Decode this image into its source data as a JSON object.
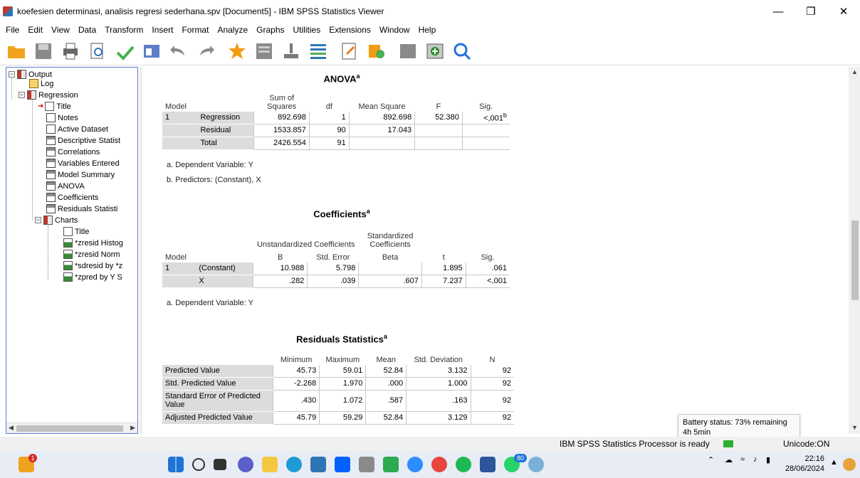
{
  "window": {
    "title": "koefesien determinasi, analisis regresi sederhana.spv [Document5] - IBM SPSS Statistics Viewer"
  },
  "menus": [
    {
      "label": "File"
    },
    {
      "label": "Edit"
    },
    {
      "label": "View"
    },
    {
      "label": "Data"
    },
    {
      "label": "Transform"
    },
    {
      "label": "Insert"
    },
    {
      "label": "Format"
    },
    {
      "label": "Analyze"
    },
    {
      "label": "Graphs"
    },
    {
      "label": "Utilities"
    },
    {
      "label": "Extensions"
    },
    {
      "label": "Window"
    },
    {
      "label": "Help"
    }
  ],
  "toolbar_icons": [
    "open-folder-icon",
    "save-icon",
    "print-icon",
    "print-preview-icon",
    "export-icon",
    "recall-dialog-icon",
    "undo-icon",
    "redo-icon",
    "goto-data-icon",
    "goto-case-icon",
    "goto-variable-icon",
    "variables-icon",
    "designate-window-icon",
    "show-all-icon",
    "select-last-output-icon",
    "hide-icon",
    "insert-output-icon",
    "search-icon"
  ],
  "tree": [
    {
      "label": "Output",
      "level": 0,
      "icon": "book",
      "toggle": "−"
    },
    {
      "label": "Log",
      "level": 1,
      "icon": "log"
    },
    {
      "label": "Regression",
      "level": 1,
      "icon": "book",
      "toggle": "−"
    },
    {
      "label": "Title",
      "level": 2,
      "icon": "title",
      "current": true
    },
    {
      "label": "Notes",
      "level": 2,
      "icon": "note"
    },
    {
      "label": "Active Dataset",
      "level": 2,
      "icon": "note"
    },
    {
      "label": "Descriptive Statist",
      "level": 2,
      "icon": "table"
    },
    {
      "label": "Correlations",
      "level": 2,
      "icon": "table"
    },
    {
      "label": "Variables Entered",
      "level": 2,
      "icon": "table"
    },
    {
      "label": "Model Summary",
      "level": 2,
      "icon": "table"
    },
    {
      "label": "ANOVA",
      "level": 2,
      "icon": "table"
    },
    {
      "label": "Coefficients",
      "level": 2,
      "icon": "table"
    },
    {
      "label": "Residuals Statisti",
      "level": 2,
      "icon": "table"
    },
    {
      "label": "Charts",
      "level": 2,
      "icon": "book",
      "toggle": "−"
    },
    {
      "label": "Title",
      "level": 3,
      "icon": "title"
    },
    {
      "label": "*zresid Histog",
      "level": 3,
      "icon": "chart"
    },
    {
      "label": "*zresid Norm",
      "level": 3,
      "icon": "chart"
    },
    {
      "label": "*sdresid by *z",
      "level": 3,
      "icon": "chart"
    },
    {
      "label": "*zpred by Y S",
      "level": 3,
      "icon": "chart"
    }
  ],
  "anova": {
    "title": "ANOVA",
    "title_sup": "a",
    "headers": {
      "model": "Model",
      "ss": "Sum of Squares",
      "df": "df",
      "ms": "Mean Square",
      "f": "F",
      "sig": "Sig."
    },
    "model_num": "1",
    "rows": [
      {
        "label": "Regression",
        "ss": "892.698",
        "df": "1",
        "ms": "892.698",
        "f": "52.380",
        "sig": "<,001",
        "sig_sup": "b"
      },
      {
        "label": "Residual",
        "ss": "1533.857",
        "df": "90",
        "ms": "17.043",
        "f": "",
        "sig": ""
      },
      {
        "label": "Total",
        "ss": "2426.554",
        "df": "91",
        "ms": "",
        "f": "",
        "sig": ""
      }
    ],
    "footnotes": [
      "a. Dependent Variable: Y",
      "b. Predictors: (Constant), X"
    ]
  },
  "coefficients": {
    "title": "Coefficients",
    "title_sup": "a",
    "headers": {
      "model": "Model",
      "unstd": "Unstandardized Coefficients",
      "std": "Standardized Coefficients",
      "b": "B",
      "se": "Std. Error",
      "beta": "Beta",
      "t": "t",
      "sig": "Sig."
    },
    "model_num": "1",
    "rows": [
      {
        "label": "(Constant)",
        "b": "10.988",
        "se": "5.798",
        "beta": "",
        "t": "1.895",
        "sig": ".061"
      },
      {
        "label": "X",
        "b": ".282",
        "se": ".039",
        "beta": ".607",
        "t": "7.237",
        "sig": "<,001"
      }
    ],
    "footnotes": [
      "a. Dependent Variable: Y"
    ]
  },
  "residuals": {
    "title": "Residuals Statistics",
    "title_sup": "a",
    "headers": {
      "min": "Minimum",
      "max": "Maximum",
      "mean": "Mean",
      "sd": "Std. Deviation",
      "n": "N"
    },
    "rows": [
      {
        "label": "Predicted Value",
        "min": "45.73",
        "max": "59.01",
        "mean": "52.84",
        "sd": "3.132",
        "n": "92"
      },
      {
        "label": "Std. Predicted Value",
        "min": "-2.268",
        "max": "1.970",
        "mean": ".000",
        "sd": "1.000",
        "n": "92"
      },
      {
        "label": "Standard Error of Predicted Value",
        "min": ".430",
        "max": "1.072",
        "mean": ".587",
        "sd": ".163",
        "n": "92"
      },
      {
        "label": "Adjusted Predicted Value",
        "min": "45.79",
        "max": "59.29",
        "mean": "52.84",
        "sd": "3.129",
        "n": "92"
      }
    ]
  },
  "tooltip": {
    "line1": "Battery status: 73% remaining",
    "line2": "4h 5min"
  },
  "status": {
    "processor": "IBM SPSS Statistics Processor is ready",
    "encoding": "Unicode:ON"
  },
  "clock": {
    "time": "22:16",
    "date": "28/06/2024"
  },
  "taskbar_badges": {
    "notification": "1",
    "whatsapp": "80"
  }
}
